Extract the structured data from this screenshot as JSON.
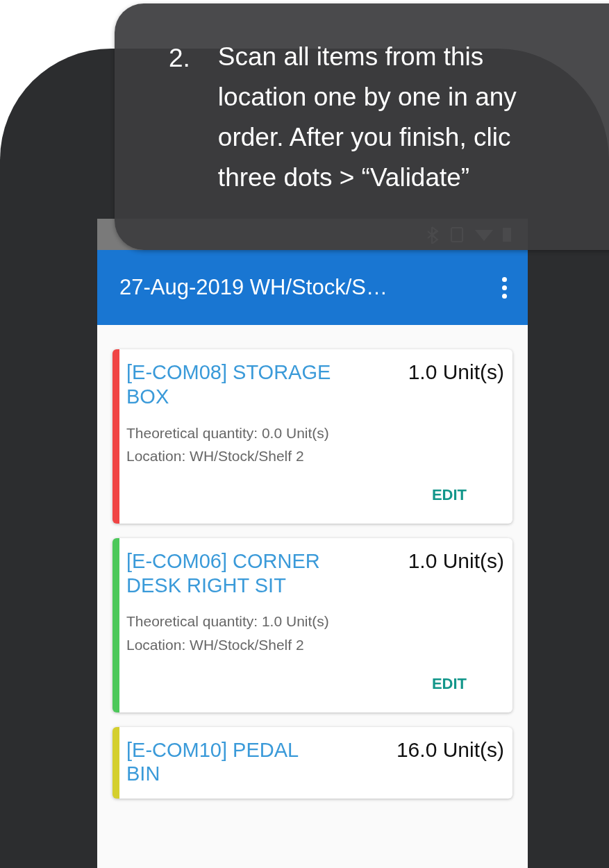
{
  "tooltip": {
    "number": "2.",
    "lines": [
      "Scan all items from this",
      "location one by one in any",
      "order. After you finish, clic",
      "three dots > “Validate”"
    ]
  },
  "app_bar": {
    "title": "27-Aug-2019  WH/Stock/S…"
  },
  "cards": [
    {
      "name": "[E-COM08] STORAGE BOX",
      "quantity": "1.0 Unit(s)",
      "theoretical": "Theoretical quantity: 0.0 Unit(s)",
      "location": "Location: WH/Stock/Shelf 2",
      "action": "EDIT",
      "color": "#f04444"
    },
    {
      "name": "[E-COM06] CORNER DESK RIGHT SIT",
      "quantity": "1.0 Unit(s)",
      "theoretical": "Theoretical quantity: 1.0 Unit(s)",
      "location": "Location: WH/Stock/Shelf 2",
      "action": "EDIT",
      "color": "#4cc85a"
    },
    {
      "name": "[E-COM10] PEDAL BIN",
      "quantity": "16.0 Unit(s)",
      "color": "#d4cf2e"
    }
  ]
}
